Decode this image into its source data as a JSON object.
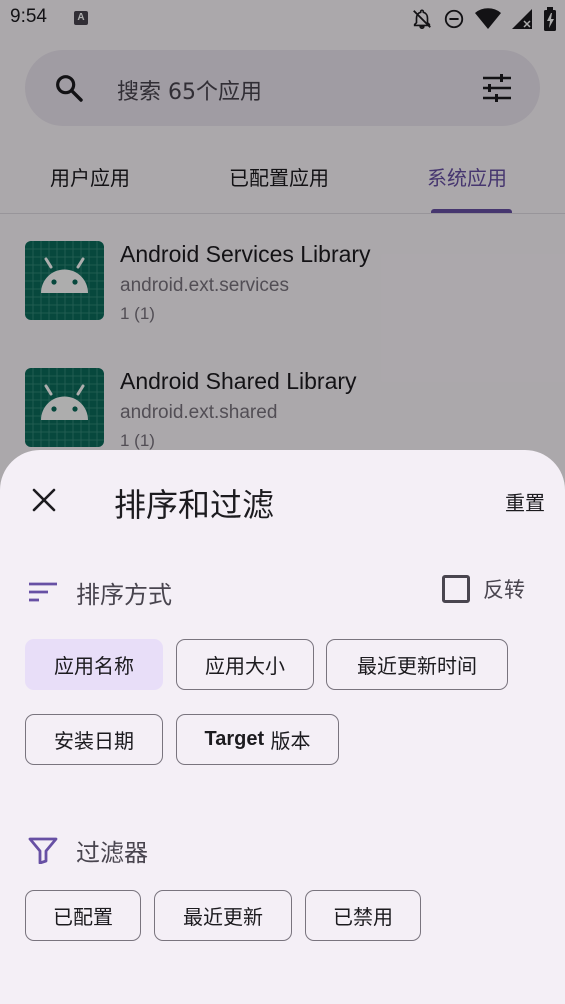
{
  "status_bar": {
    "time": "9:54",
    "notification_badge": "A",
    "icons": [
      "notifications-off-icon",
      "do-not-disturb-icon",
      "wifi-icon",
      "signal-icon",
      "battery-icon"
    ]
  },
  "search": {
    "placeholder": "搜索 65个应用",
    "icon": "search-icon",
    "filter_icon": "tune-icon"
  },
  "tabs": [
    {
      "label": "用户应用",
      "active": false
    },
    {
      "label": "已配置应用",
      "active": false
    },
    {
      "label": "系统应用",
      "active": true
    }
  ],
  "apps": [
    {
      "name": "Android Services Library",
      "package": "android.ext.services",
      "version": "1 (1)",
      "icon": "android-icon"
    },
    {
      "name": "Android Shared Library",
      "package": "android.ext.shared",
      "version": "1 (1)",
      "icon": "android-icon"
    }
  ],
  "sheet": {
    "title": "排序和过滤",
    "reset_label": "重置",
    "sort": {
      "label": "排序方式",
      "reverse_label": "反转",
      "reverse_checked": false,
      "options": [
        {
          "label": "应用名称",
          "selected": true
        },
        {
          "label": "应用大小",
          "selected": false
        },
        {
          "label": "最近更新时间",
          "selected": false
        },
        {
          "label": "安装日期",
          "selected": false
        },
        {
          "label_prefix": "Target",
          "label_suffix": " 版本",
          "selected": false
        }
      ]
    },
    "filter": {
      "label": "过滤器",
      "options": [
        {
          "label": "已配置"
        },
        {
          "label": "最近更新"
        },
        {
          "label": "已禁用"
        }
      ]
    }
  },
  "colors": {
    "accent": "#6750a4",
    "chip_selected": "#e8def8",
    "sheet_bg": "#f4eff6",
    "app_icon_bg": "#0b6b5a"
  }
}
